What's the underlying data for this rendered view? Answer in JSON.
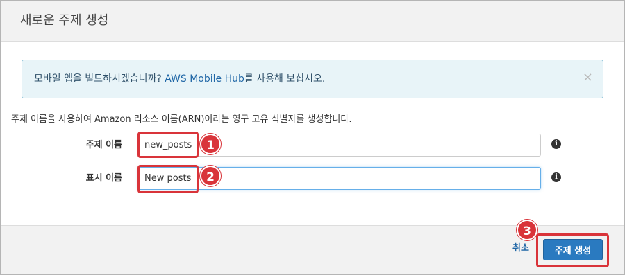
{
  "dialog": {
    "title": "새로운 주제 생성"
  },
  "alert": {
    "text_before": "모바일 앱을 빌드하시겠습니까? ",
    "link_text": "AWS Mobile Hub",
    "text_after": "를 사용해 보십시오.",
    "close_symbol": "×"
  },
  "description": "주제 이름을 사용하여 Amazon 리소스 이름(ARN)이라는 영구 고유 식별자를 생성합니다.",
  "form": {
    "topic_name": {
      "label": "주제 이름",
      "value": "new_posts"
    },
    "display_name": {
      "label": "표시 이름",
      "value": "New posts"
    }
  },
  "annotations": {
    "step1": "1",
    "step2": "2",
    "step3": "3"
  },
  "footer": {
    "cancel_label": "취소",
    "create_label": "주제 생성"
  },
  "icons": {
    "info": "i"
  },
  "colors": {
    "primary": "#2a7ac0",
    "highlight": "#d9343a",
    "alert_bg": "#e8f4f8",
    "alert_border": "#6aaecb"
  }
}
